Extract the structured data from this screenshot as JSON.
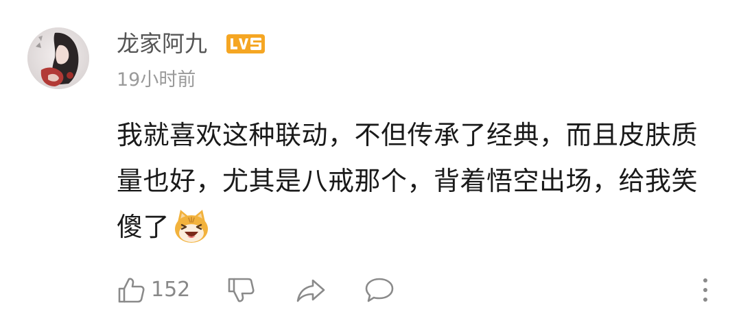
{
  "comment": {
    "username": "龙家阿九",
    "level_badge": "LV5",
    "timestamp": "19小时前",
    "text": "我就喜欢这种联动，不但传承了经典，而且皮肤质量也好，尤其是八戒那个，背着悟空出场，给我笑傻了",
    "emoji_icon": "laughing-cat-emoji-icon",
    "like_count": "152"
  },
  "colors": {
    "badge": "#f5a623",
    "username": "#555555",
    "timestamp": "#9a9a9a",
    "text": "#1a1a1a",
    "icon": "#8a8a8a"
  },
  "icons": {
    "like": "thumbs-up-icon",
    "dislike": "thumbs-down-icon",
    "share": "share-icon",
    "reply": "comment-bubble-icon",
    "more": "more-vertical-icon"
  }
}
